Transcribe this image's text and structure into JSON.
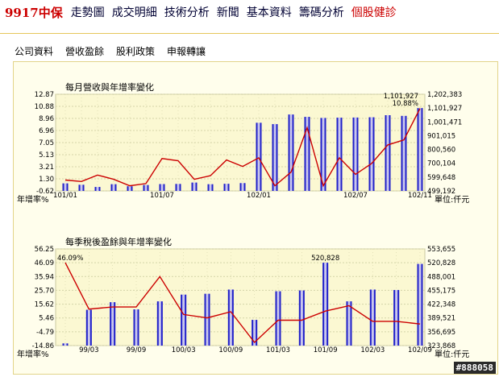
{
  "topnav": {
    "stock_code": "9917中保",
    "items": [
      "走勢圖",
      "成交明細",
      "技術分析",
      "新聞",
      "基本資料",
      "籌碼分析",
      "個股健診"
    ]
  },
  "subnav": {
    "items": [
      "公司資料",
      "營收盈餘",
      "股利政策",
      "申報轉讓"
    ]
  },
  "colors": {
    "bar_fill": "#c9c6f2",
    "bar_dark": "#2020c8",
    "line": "#cc0000",
    "plot_bg": "#fbf8d2",
    "grid": "#d4d4a8",
    "brand_red": "#cc0000"
  },
  "watermark": "#888058",
  "chart_data": [
    {
      "type": "bar",
      "title": "每月營收與年增率變化",
      "left_axis_label": "年增率%",
      "right_axis_label": "單位:仟元",
      "left_ticks": [
        "12.87",
        "10.88",
        "8.96",
        "6.96",
        "7.05",
        "5.13",
        "3.21",
        "1.30",
        "-0.62"
      ],
      "right_ticks": [
        "1,202,383",
        "1,101,927",
        "1,001,471",
        "901,015",
        "800,560",
        "700,104",
        "599,648",
        "499,192"
      ],
      "x_labels": [
        "101/01",
        "101/07",
        "102/01",
        "102/07",
        "102/11"
      ],
      "ylim_left": [
        -0.62,
        12.87
      ],
      "ylim_right": [
        499192,
        1202383
      ],
      "bar_values": [
        554000,
        544000,
        528000,
        548000,
        533000,
        542000,
        549000,
        550000,
        560000,
        548000,
        551000,
        556000,
        995000,
        985000,
        1055000,
        1038000,
        1030000,
        1032000,
        1033000,
        1035000,
        1050000,
        1045000,
        1101927
      ],
      "growth_values": [
        0.9,
        0.7,
        1.6,
        1.0,
        0.1,
        0.4,
        3.9,
        3.6,
        1.0,
        1.5,
        3.7,
        2.8,
        4.0,
        0.1,
        2.0,
        8.2,
        0.1,
        4.0,
        1.7,
        3.2,
        5.8,
        6.5,
        10.88
      ],
      "annotations": {
        "max_value": "1,101,927",
        "max_growth": "10.88%"
      }
    },
    {
      "type": "bar",
      "title": "每季稅後盈餘與年增率變化",
      "left_axis_label": "年增率%",
      "right_axis_label": "單位:仟元",
      "left_ticks": [
        "56.25",
        "46.09",
        "35.94",
        "25.70",
        "15.62",
        "5.46",
        "-4.79",
        "-14.86"
      ],
      "right_ticks": [
        "553,655",
        "520,828",
        "488,001",
        "455,175",
        "422,348",
        "389,521",
        "356,695",
        "323,868"
      ],
      "x_labels": [
        "99/03",
        "99/09",
        "100/03",
        "100/09",
        "101/03",
        "101/09",
        "102/03",
        "102/09"
      ],
      "ylim_left": [
        -14.86,
        56.25
      ],
      "ylim_right": [
        323868,
        553655
      ],
      "bar_values": [
        329000,
        409000,
        427000,
        410000,
        429000,
        445000,
        447000,
        457000,
        385000,
        453000,
        455000,
        520828,
        429000,
        457000,
        456000,
        518000
      ],
      "growth_values": [
        46.09,
        12.0,
        13.5,
        13.5,
        35.94,
        8.0,
        5.5,
        10.0,
        -12.5,
        3.8,
        3.8,
        10.5,
        14.5,
        3.0,
        3.0,
        1.0
      ],
      "annotations": {
        "max_value": "520,828",
        "max_growth": "46.09%"
      }
    }
  ]
}
